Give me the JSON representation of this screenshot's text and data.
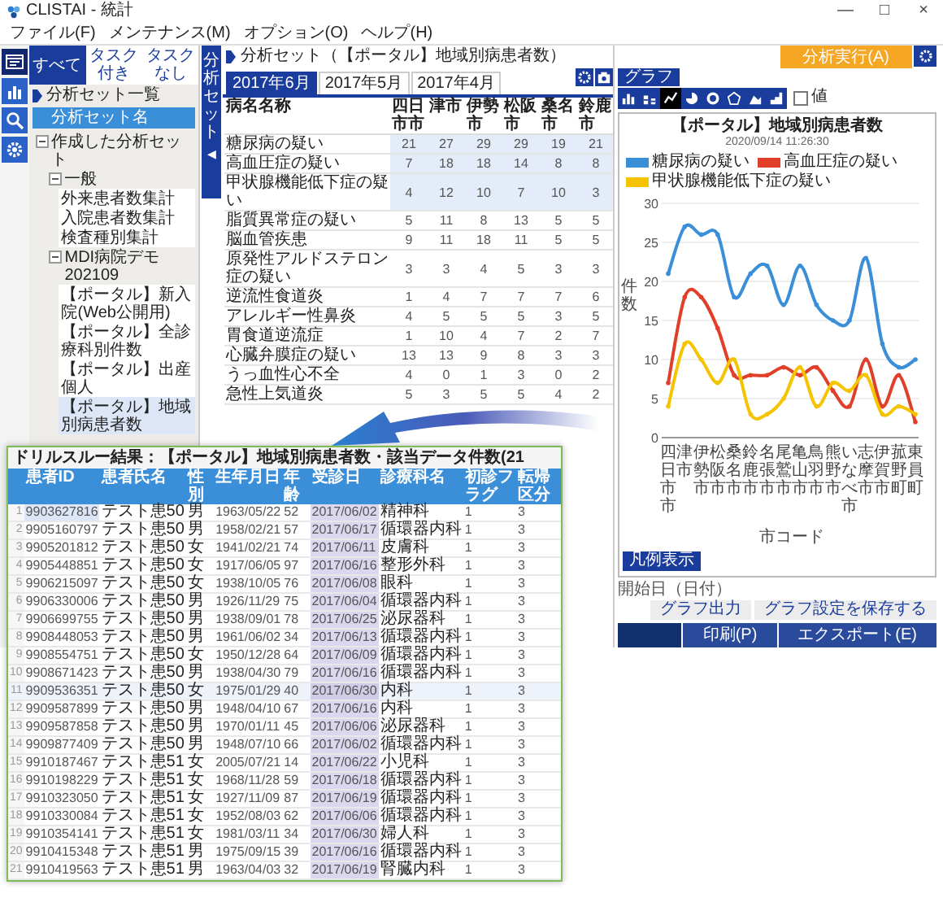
{
  "window": {
    "title": "CLISTAI - 統計",
    "controls": [
      "—",
      "□",
      "×"
    ]
  },
  "menu": [
    "ファイル(F)",
    "メンテナンス(M)",
    "オプション(O)",
    "ヘルプ(H)"
  ],
  "side_icons": [
    {
      "kind": "window",
      "selected": true
    },
    {
      "kind": "chart",
      "selected": false
    },
    {
      "kind": "search",
      "selected": false
    },
    {
      "kind": "settings",
      "selected": false
    }
  ],
  "tree": {
    "tabs": [
      {
        "label": "すべて",
        "selected": true
      },
      {
        "label": "タスク付き",
        "selected": false
      },
      {
        "label": "タスクなし",
        "selected": false
      }
    ],
    "title": "分析セット一覧",
    "column": "分析セット名",
    "items": [
      {
        "label": "作成した分析セット",
        "expanded": true,
        "children": [
          {
            "label": "一般",
            "expanded": true,
            "children": [
              {
                "label": "外来患者数集計",
                "selected": false
              },
              {
                "label": "入院患者数集計",
                "selected": false
              },
              {
                "label": "検査種別集計",
                "selected": false
              }
            ]
          },
          {
            "label": "MDI病院デモ202109",
            "expanded": true,
            "children": [
              {
                "label": "【ポータル】新入院(Web公開用)",
                "selected": false
              },
              {
                "label": "【ポータル】全診療科別件数",
                "selected": false
              },
              {
                "label": "【ポータル】出産個人",
                "selected": false
              },
              {
                "label": "【ポータル】地域別病患者数",
                "selected": true
              }
            ]
          }
        ]
      }
    ]
  },
  "side_tab": {
    "label": "分析セット",
    "toggle": "◀"
  },
  "panel": {
    "title": "分析セット（【ポータル】地域別病患者数）",
    "tabs": [
      {
        "label": "2017年6月",
        "selected": true
      },
      {
        "label": "2017年5月",
        "selected": false
      },
      {
        "label": "2017年4月",
        "selected": false
      }
    ],
    "table": {
      "columns": [
        "病名名称",
        "四日市市",
        "津市",
        "伊勢市",
        "松阪市",
        "桑名市",
        "鈴鹿市"
      ],
      "rows": [
        {
          "name": "糖尿病の疑い",
          "values": [
            "21",
            "27",
            "29",
            "29",
            "19",
            "21"
          ],
          "selected": true
        },
        {
          "name": "高血圧症の疑い",
          "values": [
            "7",
            "18",
            "18",
            "14",
            "8",
            "8"
          ],
          "selected": true
        },
        {
          "name": "甲状腺機能低下症の疑い",
          "values": [
            "4",
            "12",
            "10",
            "7",
            "10",
            "3"
          ],
          "selected": true
        },
        {
          "name": "脂質異常症の疑い",
          "values": [
            "5",
            "11",
            "8",
            "13",
            "5",
            "5"
          ],
          "selected": false
        },
        {
          "name": "脳血管疾患",
          "values": [
            "9",
            "11",
            "18",
            "11",
            "5",
            "5"
          ],
          "selected": false
        },
        {
          "name": "原発性アルドステロン症の疑い",
          "values": [
            "3",
            "3",
            "4",
            "5",
            "3",
            "3"
          ],
          "selected": false
        },
        {
          "name": "逆流性食道炎",
          "values": [
            "1",
            "4",
            "7",
            "7",
            "7",
            "6"
          ],
          "selected": false
        },
        {
          "name": "アレルギー性鼻炎",
          "values": [
            "4",
            "5",
            "5",
            "5",
            "3",
            "5"
          ],
          "selected": false
        },
        {
          "name": "胃食道逆流症",
          "values": [
            "1",
            "10",
            "4",
            "7",
            "2",
            "7"
          ],
          "selected": false
        },
        {
          "name": "心臓弁膜症の疑い",
          "values": [
            "13",
            "13",
            "9",
            "8",
            "3",
            "3"
          ],
          "selected": false
        },
        {
          "name": "うっ血性心不全",
          "values": [
            "4",
            "0",
            "1",
            "3",
            "0",
            "2"
          ],
          "selected": false
        },
        {
          "name": "急性上気道炎",
          "values": [
            "5",
            "3",
            "5",
            "5",
            "4",
            "2"
          ],
          "selected": false
        }
      ]
    }
  },
  "graph_panel": {
    "run_button": "分析実行(A)",
    "tab": "グラフ",
    "chart_types": [
      {
        "kind": "bar",
        "selected": false
      },
      {
        "kind": "stacked-bar",
        "selected": false
      },
      {
        "kind": "line",
        "selected": true
      },
      {
        "kind": "pie",
        "selected": false
      },
      {
        "kind": "donut",
        "selected": false
      },
      {
        "kind": "radar",
        "selected": false
      },
      {
        "kind": "area",
        "selected": false
      },
      {
        "kind": "step",
        "selected": false
      }
    ],
    "value_checkbox": {
      "label": "値",
      "checked": false
    },
    "subtitle": "2020/09/14 11:26:30",
    "chart_data": {
      "type": "line",
      "title": "【ポータル】地域別病患者数",
      "xlabel": "市コード",
      "ylabel": "件数",
      "categories": [
        "四日市市",
        "津市",
        "伊勢市",
        "松阪市",
        "桑名市",
        "鈴鹿市",
        "名張市",
        "尾鷲市",
        "亀山市",
        "鳥羽市",
        "熊野市",
        "いなべ市",
        "志摩市",
        "伊賀市",
        "菰野町",
        "東員町"
      ],
      "series": [
        {
          "name": "糖尿病の疑い",
          "color": "#3a8fd8",
          "values": [
            21,
            27,
            26,
            26,
            18,
            21,
            22,
            17,
            22,
            17,
            15,
            15,
            23,
            12,
            9,
            10
          ]
        },
        {
          "name": "高血圧症の疑い",
          "color": "#e0402a",
          "values": [
            7,
            18,
            18,
            14,
            8,
            8,
            8,
            9,
            8,
            9,
            6,
            4,
            10,
            4,
            8,
            2
          ]
        },
        {
          "name": "甲状腺機能低下症の疑い",
          "color": "#f5c400",
          "values": [
            4,
            12,
            10,
            7,
            10,
            3,
            3,
            5,
            9,
            4,
            7,
            6,
            8,
            3,
            4,
            3
          ]
        }
      ],
      "ylim": [
        0,
        30
      ],
      "yticks": [
        0,
        5,
        10,
        15,
        20,
        25,
        30
      ],
      "grid": true
    },
    "legend_button": "凡例表示",
    "date_note": "開始日（日付）",
    "export_graph": "グラフ出力",
    "save_settings": "グラフ設定を保存する",
    "print": "印刷(P)",
    "export": "エクスポート(E)"
  },
  "drillthrough": {
    "title": "ドリルスルー結果：【ポータル】地域別病患者数・該当データ件数(21",
    "columns": [
      "患者ID",
      "患者氏名",
      "性別",
      "生年月日",
      "年齢",
      "受診日",
      "診療科名",
      "初診フラグ",
      "転帰区分"
    ],
    "rows": [
      {
        "no": "1",
        "cells": [
          "9903627816",
          "テスト患50",
          "男",
          "1963/05/22",
          "52",
          "2017/06/02",
          "精神科",
          "1",
          "3"
        ],
        "selected": false
      },
      {
        "no": "2",
        "cells": [
          "9905160797",
          "テスト患50",
          "男",
          "1958/02/21",
          "57",
          "2017/06/17",
          "循環器内科",
          "1",
          "3"
        ],
        "selected": false
      },
      {
        "no": "3",
        "cells": [
          "9905201812",
          "テスト患50",
          "女",
          "1941/02/21",
          "74",
          "2017/06/11",
          "皮膚科",
          "1",
          "3"
        ],
        "selected": false
      },
      {
        "no": "4",
        "cells": [
          "9905448851",
          "テスト患50",
          "女",
          "1917/06/05",
          "97",
          "2017/06/16",
          "整形外科",
          "1",
          "3"
        ],
        "selected": false
      },
      {
        "no": "5",
        "cells": [
          "9906215097",
          "テスト患50",
          "女",
          "1938/10/05",
          "76",
          "2017/06/08",
          "眼科",
          "1",
          "3"
        ],
        "selected": false
      },
      {
        "no": "6",
        "cells": [
          "9906330006",
          "テスト患50",
          "男",
          "1926/11/29",
          "75",
          "2017/06/04",
          "循環器内科",
          "1",
          "3"
        ],
        "selected": false
      },
      {
        "no": "7",
        "cells": [
          "9906699755",
          "テスト患50",
          "男",
          "1938/09/01",
          "78",
          "2017/06/25",
          "泌尿器科",
          "1",
          "3"
        ],
        "selected": false
      },
      {
        "no": "8",
        "cells": [
          "9908448053",
          "テスト患50",
          "男",
          "1961/06/02",
          "34",
          "2017/06/13",
          "循環器内科",
          "1",
          "3"
        ],
        "selected": false
      },
      {
        "no": "9",
        "cells": [
          "9908554751",
          "テスト患50",
          "女",
          "1950/12/28",
          "64",
          "2017/06/09",
          "循環器内科",
          "1",
          "3"
        ],
        "selected": false
      },
      {
        "no": "10",
        "cells": [
          "9908671423",
          "テスト患50",
          "男",
          "1938/04/30",
          "79",
          "2017/06/16",
          "循環器内科",
          "1",
          "3"
        ],
        "selected": false
      },
      {
        "no": "11",
        "cells": [
          "9909536351",
          "テスト患50",
          "女",
          "1975/01/29",
          "40",
          "2017/06/30",
          "内科",
          "1",
          "3"
        ],
        "selected": true
      },
      {
        "no": "12",
        "cells": [
          "9909587899",
          "テスト患50",
          "男",
          "1948/04/10",
          "67",
          "2017/06/16",
          "内科",
          "1",
          "3"
        ],
        "selected": false
      },
      {
        "no": "13",
        "cells": [
          "9909587858",
          "テスト患50",
          "男",
          "1970/01/11",
          "45",
          "2017/06/06",
          "泌尿器科",
          "1",
          "3"
        ],
        "selected": false
      },
      {
        "no": "14",
        "cells": [
          "9909877409",
          "テスト患50",
          "男",
          "1948/07/10",
          "66",
          "2017/06/02",
          "循環器内科",
          "1",
          "3"
        ],
        "selected": false
      },
      {
        "no": "15",
        "cells": [
          "9910187467",
          "テスト患51",
          "女",
          "2005/07/21",
          "14",
          "2017/06/22",
          "小児科",
          "1",
          "3"
        ],
        "selected": false
      },
      {
        "no": "16",
        "cells": [
          "9910198229",
          "テスト患51",
          "女",
          "1968/11/28",
          "59",
          "2017/06/18",
          "循環器内科",
          "1",
          "3"
        ],
        "selected": false
      },
      {
        "no": "17",
        "cells": [
          "9910323050",
          "テスト患51",
          "女",
          "1927/11/09",
          "87",
          "2017/06/19",
          "循環器内科",
          "1",
          "3"
        ],
        "selected": false
      },
      {
        "no": "18",
        "cells": [
          "9910330084",
          "テスト患51",
          "女",
          "1952/08/03",
          "62",
          "2017/06/06",
          "循環器内科",
          "1",
          "3"
        ],
        "selected": false
      },
      {
        "no": "19",
        "cells": [
          "9910354141",
          "テスト患51",
          "女",
          "1981/03/11",
          "34",
          "2017/06/30",
          "婦人科",
          "1",
          "3"
        ],
        "selected": false
      },
      {
        "no": "20",
        "cells": [
          "9910415348",
          "テスト患51",
          "男",
          "1975/09/15",
          "39",
          "2017/06/16",
          "循環器内科",
          "1",
          "3"
        ],
        "selected": false
      },
      {
        "no": "21",
        "cells": [
          "9910419563",
          "テスト患51",
          "男",
          "1963/04/03",
          "32",
          "2017/06/19",
          "腎臓内科",
          "1",
          "3"
        ],
        "selected": false
      }
    ]
  }
}
